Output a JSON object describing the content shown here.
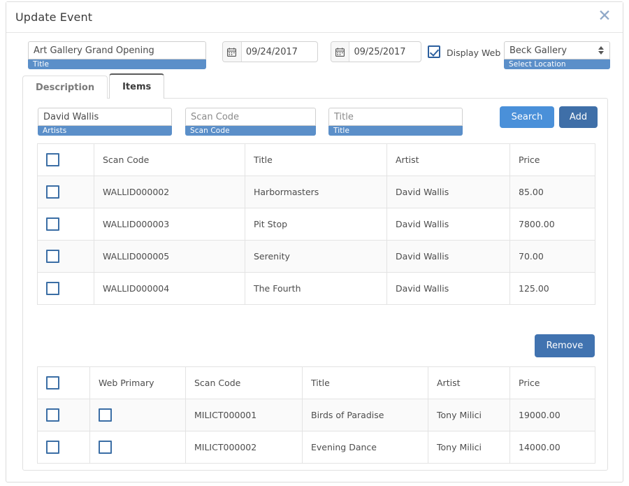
{
  "dialog": {
    "title": "Update Event",
    "close_icon": "close-icon"
  },
  "form": {
    "event_title": {
      "value": "Art Gallery Grand Opening",
      "label": "Title"
    },
    "start_date": {
      "value": "09/24/2017",
      "icon": "calendar-icon"
    },
    "end_date": {
      "value": "09/25/2017",
      "icon": "calendar-icon"
    },
    "display_web": {
      "label": "Display Web",
      "checked": true
    },
    "location": {
      "value": "Beck Gallery",
      "label": "Select Location",
      "icon": "spinner-arrows-icon"
    }
  },
  "tabs": [
    {
      "label": "Description",
      "active": false
    },
    {
      "label": "Items",
      "active": true
    }
  ],
  "search": {
    "artists": {
      "value": "David Wallis",
      "placeholder": "Artists",
      "label": "Artists"
    },
    "scan_code": {
      "value": "",
      "placeholder": "Scan Code",
      "label": "Scan Code"
    },
    "title": {
      "value": "",
      "placeholder": "Title",
      "label": "Title"
    },
    "search_button": "Search",
    "add_button": "Add"
  },
  "results_table": {
    "columns": [
      "",
      "Scan Code",
      "Title",
      "Artist",
      "Price"
    ],
    "rows": [
      {
        "checked": false,
        "scan_code": "WALLID000002",
        "title": "Harbormasters",
        "artist": "David Wallis",
        "price": "85.00"
      },
      {
        "checked": false,
        "scan_code": "WALLID000003",
        "title": "Pit Stop",
        "artist": "David Wallis",
        "price": "7800.00"
      },
      {
        "checked": false,
        "scan_code": "WALLID000005",
        "title": "Serenity",
        "artist": "David Wallis",
        "price": "70.00"
      },
      {
        "checked": false,
        "scan_code": "WALLID000004",
        "title": "The Fourth",
        "artist": "David Wallis",
        "price": "125.00"
      }
    ]
  },
  "remove_button": "Remove",
  "selected_table": {
    "columns": [
      "",
      "Web Primary",
      "Scan Code",
      "Title",
      "Artist",
      "Price"
    ],
    "rows": [
      {
        "checked": false,
        "web_primary": false,
        "scan_code": "MILICT000001",
        "title": "Birds of Paradise",
        "artist": "Tony Milici",
        "price": "19000.00"
      },
      {
        "checked": false,
        "web_primary": false,
        "scan_code": "MILICT000002",
        "title": "Evening Dance",
        "artist": "Tony Milici",
        "price": "14000.00"
      }
    ]
  },
  "colors": {
    "field_label_blue": "#5b8fc9",
    "search_blue": "#4a90d9",
    "add_blue": "#3f6fa8",
    "remove_blue": "#4173b0",
    "checkbox_border": "#3b6ea5",
    "close_icon": "#8fa8c8"
  }
}
